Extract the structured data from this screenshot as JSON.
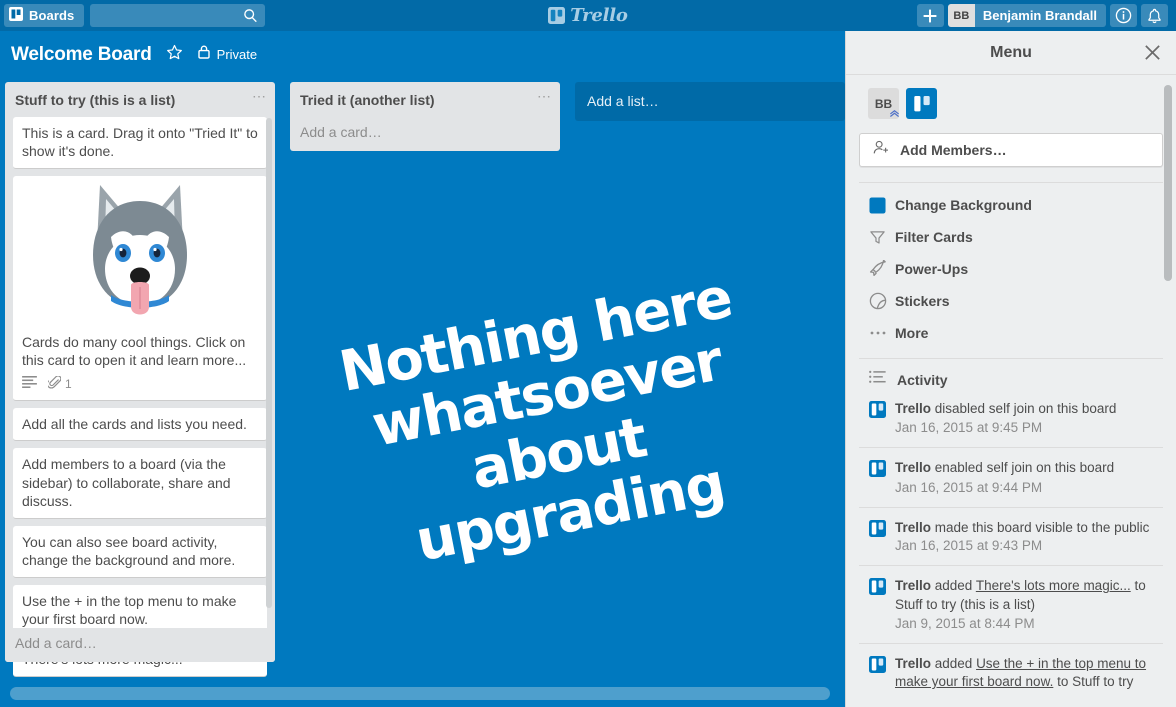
{
  "topbar": {
    "boards_label": "Boards",
    "search_placeholder": "",
    "search_value": "",
    "logo_text": "Trello",
    "add_label": "+",
    "user_initials": "BB",
    "user_name": "Benjamin Brandall",
    "info_label": "i",
    "icons": {
      "boards": "board-icon",
      "search": "search-icon",
      "add": "plus-icon",
      "info": "info-icon",
      "notifications": "bell-icon"
    }
  },
  "board_header": {
    "title": "Welcome Board",
    "star_icon": "star-icon",
    "lock_icon": "lock-icon",
    "visibility": "Private"
  },
  "board": {
    "watermark": "Nothing here whatsoever about upgrading",
    "background_color": "#0079bf",
    "add_list_label": "Add a list…",
    "lists": [
      {
        "title": "Stuff to try (this is a list)",
        "menu_icon": "ellipsis-icon",
        "add_card_label": "Add a card…",
        "cards": [
          {
            "text": "This is a card. Drag it onto \"Tried It\" to show it's done."
          },
          {
            "text": "Cards do many cool things. Click on this card to open it and learn more...",
            "image": "husky-dog-image",
            "badges": {
              "description_icon": "description-icon",
              "attachment_icon": "attachment-icon",
              "attachment_count": "1"
            }
          },
          {
            "text": "Add all the cards and lists you need."
          },
          {
            "text": "Add members to a board (via the sidebar) to collaborate, share and discuss."
          },
          {
            "text": "You can also see board activity, change the background and more."
          },
          {
            "text": "Use the + in the top menu to make your first board now."
          },
          {
            "text": "There's lots more magic..."
          }
        ]
      },
      {
        "title": "Tried it (another list)",
        "menu_icon": "ellipsis-icon",
        "add_card_label": "Add a card…",
        "cards": []
      }
    ]
  },
  "menu": {
    "title": "Menu",
    "close_icon": "close-icon",
    "members": [
      {
        "initials": "BB",
        "type": "user-avatar",
        "badge": "admin-badge"
      },
      {
        "initials": "",
        "type": "trello-avatar",
        "badge": ""
      }
    ],
    "add_members_label": "Add Members…",
    "add_members_icon": "add-person-icon",
    "items": [
      {
        "label": "Change Background",
        "icon": "color-swatch-icon"
      },
      {
        "label": "Filter Cards",
        "icon": "funnel-icon"
      },
      {
        "label": "Power-Ups",
        "icon": "rocket-icon"
      },
      {
        "label": "Stickers",
        "icon": "sticker-icon"
      },
      {
        "label": "More",
        "icon": "ellipsis-icon"
      }
    ],
    "activity": {
      "heading": "Activity",
      "heading_icon": "activity-list-icon",
      "entries": [
        {
          "who": "Trello",
          "action": " disabled self join on this board",
          "link": "",
          "tail": "",
          "time": "Jan 16, 2015 at 9:45 PM",
          "time_inline": false
        },
        {
          "who": "Trello",
          "action": " enabled self join on this board",
          "link": "",
          "tail": "",
          "time": "Jan 16, 2015 at 9:44 PM",
          "time_inline": false
        },
        {
          "who": "Trello",
          "action": " made this board visible to the public ",
          "link": "",
          "tail": "",
          "time": "Jan 16, 2015 at 9:43 PM",
          "time_inline": true
        },
        {
          "who": "Trello",
          "action": " added ",
          "link": "There's lots more magic...",
          "tail": " to Stuff to try (this is a list)",
          "time": "Jan 9, 2015 at 8:44 PM",
          "time_inline": false
        },
        {
          "who": "Trello",
          "action": " added ",
          "link": "Use the + in the top menu to make your first board now.",
          "tail": " to Stuff to try",
          "time": "",
          "time_inline": false
        }
      ]
    }
  }
}
